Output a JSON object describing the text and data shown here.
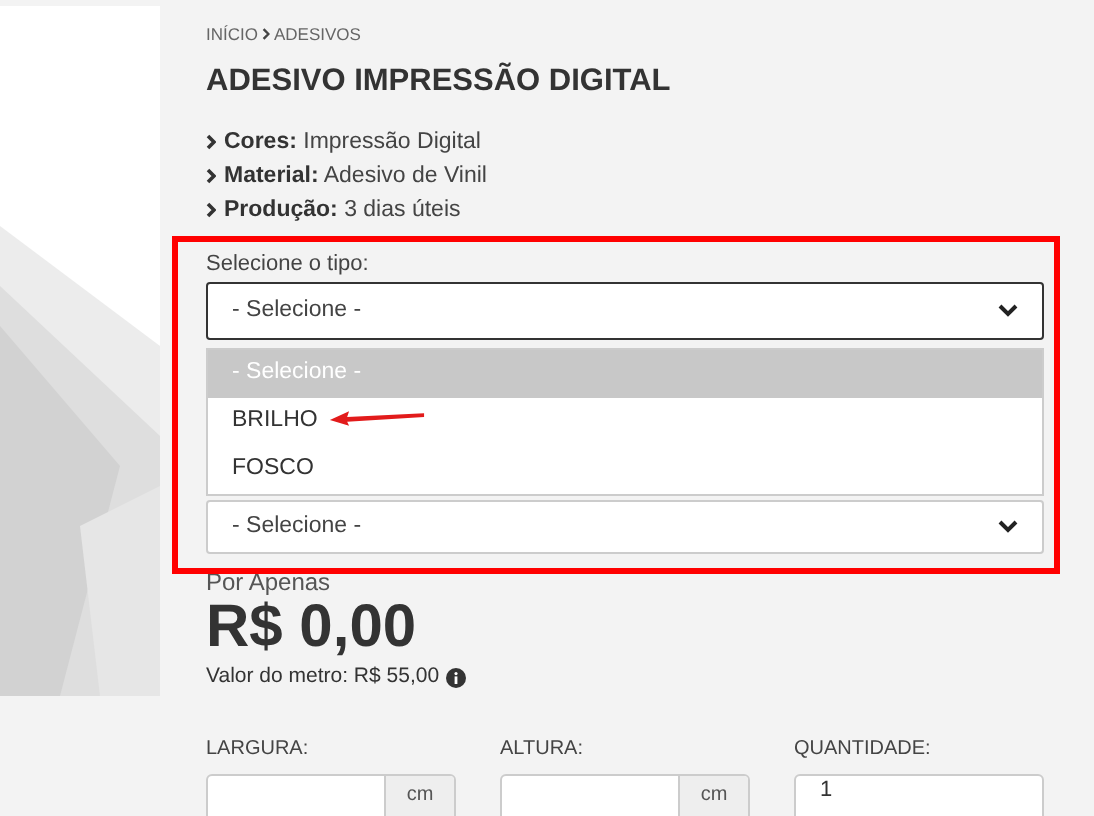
{
  "breadcrumb": [
    {
      "label": "INÍCIO"
    },
    {
      "label": "ADESIVOS"
    }
  ],
  "title": "ADESIVO IMPRESSÃO DIGITAL",
  "specs": [
    {
      "label": "Cores:",
      "value": "Impressão Digital"
    },
    {
      "label": "Material:",
      "value": "Adesivo de Vinil"
    },
    {
      "label": "Produção:",
      "value": "3 dias úteis"
    }
  ],
  "type_select": {
    "label": "Selecione o tipo:",
    "value": "- Selecione -",
    "expanded": true,
    "options": [
      {
        "label": "- Selecione -",
        "selected": true
      },
      {
        "label": "BRILHO",
        "selected": false
      },
      {
        "label": "FOSCO",
        "selected": false
      }
    ]
  },
  "second_select": {
    "value": "- Selecione -"
  },
  "price": {
    "prefix": "Por Apenas",
    "amount": "R$ 0,00",
    "unit_price": "Valor do metro: R$ 55,00"
  },
  "fields": [
    {
      "label": "LARGURA:",
      "kind": "unit",
      "unit": "cm"
    },
    {
      "label": "ALTURA:",
      "kind": "unit",
      "unit": "cm"
    },
    {
      "label": "QUANTIDADE:",
      "kind": "plain",
      "value": "1"
    }
  ]
}
